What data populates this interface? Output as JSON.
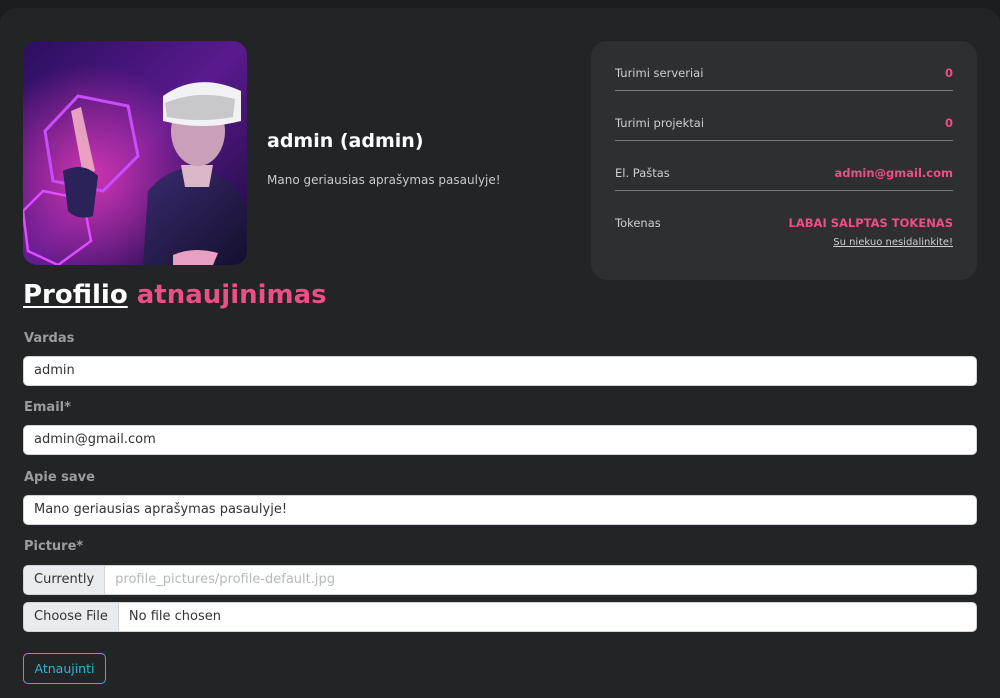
{
  "profile": {
    "name": "admin (admin)",
    "bio": "Mano geriausias aprašymas pasaulyje!"
  },
  "stats": [
    {
      "label": "Turimi serveriai",
      "value": "0"
    },
    {
      "label": "Turimi projektai",
      "value": "0"
    },
    {
      "label": "El. Paštas",
      "value": "admin@gmail.com"
    }
  ],
  "token": {
    "label": "Tokenas",
    "value": "LABAI SALPTAS TOKENAS",
    "note": "Su niekuo nesidalinkite!"
  },
  "section": {
    "title_part1": "Profilio",
    "title_part2": "atnaujinimas"
  },
  "form": {
    "name_label": "Vardas",
    "name_value": "admin",
    "email_label": "Email*",
    "email_value": "admin@gmail.com",
    "about_label": "Apie save",
    "about_value": "Mano geriausias aprašymas pasaulyje!",
    "picture_label": "Picture*",
    "currently_label": "Currently",
    "currently_value": "profile_pictures/profile-default.jpg",
    "choose_file_label": "Choose File",
    "no_file_text": "No file chosen",
    "submit_label": "Atnaujinti"
  },
  "colors": {
    "accent": "#ec4f86",
    "button": "#2bb8d6",
    "card": "#232426",
    "stats_bg": "#2e2f32"
  }
}
